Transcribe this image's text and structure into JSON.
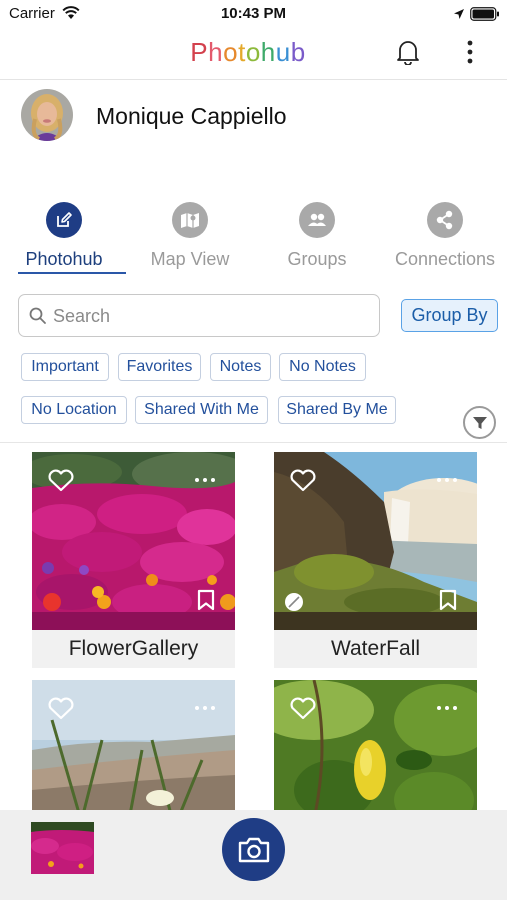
{
  "status_bar": {
    "carrier": "Carrier",
    "time": "10:43 PM"
  },
  "header": {
    "app_name_letters": [
      {
        "ch": "P",
        "color": "#d3414d"
      },
      {
        "ch": "h",
        "color": "#e35a6c"
      },
      {
        "ch": "o",
        "color": "#e6892d"
      },
      {
        "ch": "t",
        "color": "#e4a92a"
      },
      {
        "ch": "o",
        "color": "#8dba3c"
      },
      {
        "ch": "h",
        "color": "#3eaa6a"
      },
      {
        "ch": "u",
        "color": "#3a8fd3"
      },
      {
        "ch": "b",
        "color": "#7a5bc9"
      }
    ]
  },
  "profile": {
    "name": "Monique Cappiello"
  },
  "tabs": [
    {
      "label": "Photohub",
      "icon": "edit-icon",
      "active": true
    },
    {
      "label": "Map View",
      "icon": "map-icon",
      "active": false
    },
    {
      "label": "Groups",
      "icon": "groups-icon",
      "active": false
    },
    {
      "label": "Connections",
      "icon": "connections-icon",
      "active": false
    }
  ],
  "search": {
    "placeholder": "Search",
    "group_by_label": "Group By"
  },
  "filters": [
    "Important",
    "Favorites",
    "Notes",
    "No Notes",
    "No Location",
    "Shared With Me",
    "Shared By Me"
  ],
  "gallery": [
    {
      "title": "FlowerGallery",
      "status_color": "#e8342d"
    },
    {
      "title": "WaterFall",
      "status_color": "#ffffff"
    },
    {
      "title": ""
    },
    {
      "title": ""
    }
  ],
  "colors": {
    "accent": "#1f3d85",
    "tab_active": "#1d3f7d",
    "chip_text": "#23509c",
    "group_by_border": "#5aa2e6"
  }
}
